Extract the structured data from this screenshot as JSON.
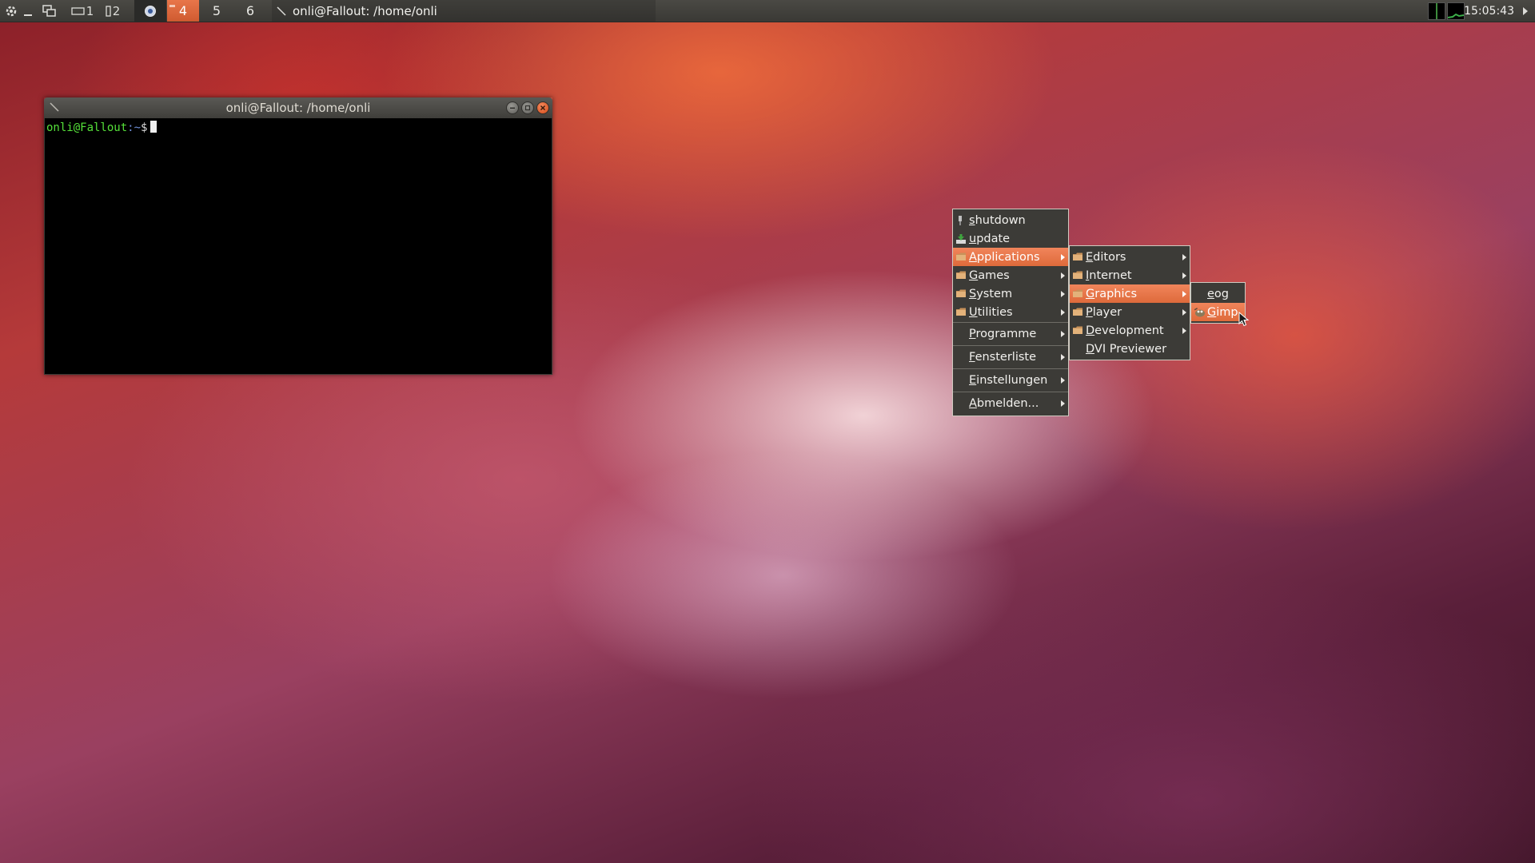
{
  "panel": {
    "workspaces": [
      "4",
      "5",
      "6"
    ],
    "workspace_active": "4",
    "pager_labels": [
      "1",
      "2"
    ],
    "task_title": "onli@Fallout: /home/onli",
    "clock": "15:05:43"
  },
  "terminal": {
    "title": "onli@Fallout: /home/onli",
    "prompt_user": "onli@Fallout",
    "prompt_path": ":~",
    "prompt_symbol": "$"
  },
  "menu_root": {
    "items": [
      {
        "label": "shutdown",
        "icon": "power-plug-icon"
      },
      {
        "label": "update",
        "icon": "download-icon"
      },
      {
        "label": "Applications",
        "icon": "folder-icon",
        "submenu": true,
        "highlighted": true
      },
      {
        "label": "Games",
        "icon": "folder-icon",
        "submenu": true
      },
      {
        "label": "System",
        "icon": "folder-icon",
        "submenu": true
      },
      {
        "label": "Utilities",
        "icon": "folder-icon",
        "submenu": true
      },
      {
        "label": "Programme",
        "submenu": true
      },
      {
        "label": "Fensterliste",
        "submenu": true
      },
      {
        "label": "Einstellungen",
        "submenu": true
      },
      {
        "label": "Abmelden...",
        "submenu": true
      }
    ]
  },
  "menu_applications": {
    "items": [
      {
        "label": "Editors",
        "icon": "folder-icon",
        "submenu": true
      },
      {
        "label": "Internet",
        "icon": "folder-icon",
        "submenu": true
      },
      {
        "label": "Graphics",
        "icon": "folder-icon",
        "submenu": true,
        "highlighted": true
      },
      {
        "label": "Player",
        "icon": "folder-icon",
        "submenu": true
      },
      {
        "label": "Development",
        "icon": "folder-icon",
        "submenu": true
      },
      {
        "label": "DVI Previewer"
      }
    ]
  },
  "menu_graphics": {
    "items": [
      {
        "label": "eog"
      },
      {
        "label": "Gimp",
        "icon": "gimp-icon",
        "highlighted": true
      }
    ]
  },
  "colors": {
    "accent": "#e8764a",
    "menu_bg": "#3c3b37",
    "panel_bg": "#3a3935",
    "prompt_green": "#55e039"
  }
}
